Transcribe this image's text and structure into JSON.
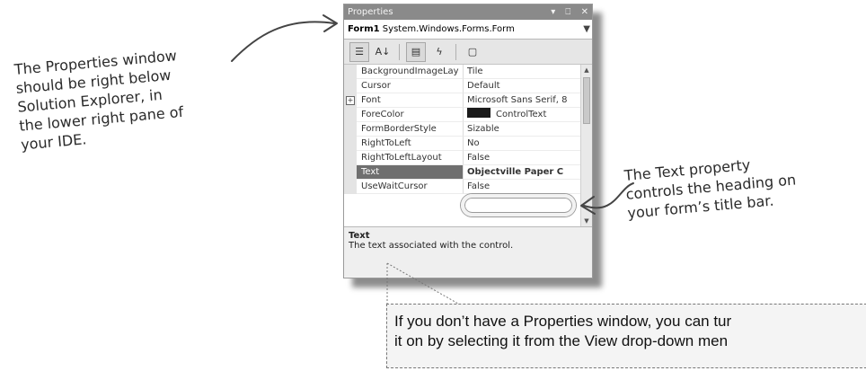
{
  "annotations": {
    "left_lines": [
      "The Properties window",
      "should be right below",
      "Solution Explorer, in",
      "the lower right pane of",
      "your IDE."
    ],
    "right_lines": [
      "The Text property",
      "controls the heading on",
      "your form’s title bar."
    ]
  },
  "properties_window": {
    "title": "Properties",
    "title_controls": "▾ ⎕ ✕",
    "object_name": "Form1",
    "object_type": "System.Windows.Forms.Form",
    "toolbar_icons": [
      "categorized-icon",
      "alphabetical-icon",
      "properties-icon",
      "events-icon",
      "property-pages-icon"
    ],
    "toolbar_glyphs": {
      "categorized": "☰",
      "alphabetical": "A↓",
      "properties": "▤",
      "events": "ϟ",
      "pages": "▢"
    },
    "rows": [
      {
        "name": "BackgroundImageLay",
        "value": "Tile",
        "expander": ""
      },
      {
        "name": "Cursor",
        "value": "Default",
        "expander": ""
      },
      {
        "name": "Font",
        "value": "Microsoft Sans Serif, 8",
        "expander": "+"
      },
      {
        "name": "ForeColor",
        "value": "ControlText",
        "expander": ""
      },
      {
        "name": "FormBorderStyle",
        "value": "Sizable",
        "expander": ""
      },
      {
        "name": "RightToLeft",
        "value": "No",
        "expander": ""
      },
      {
        "name": "RightToLeftLayout",
        "value": "False",
        "expander": ""
      },
      {
        "name": "Text",
        "value": "Objectville Paper C",
        "expander": ""
      },
      {
        "name": "UseWaitCursor",
        "value": "False",
        "expander": ""
      }
    ],
    "selected_row": "Text",
    "description_title": "Text",
    "description_text": "The text associated with the control."
  },
  "note": {
    "lines": [
      "If you don’t have a Properties window, you can tur",
      "it on by selecting it from the View drop-down men"
    ]
  },
  "colors": {
    "accent_dark": "#6f6f6f",
    "note_bg": "#f4f4f4",
    "swatch": "#1a1a1a"
  }
}
